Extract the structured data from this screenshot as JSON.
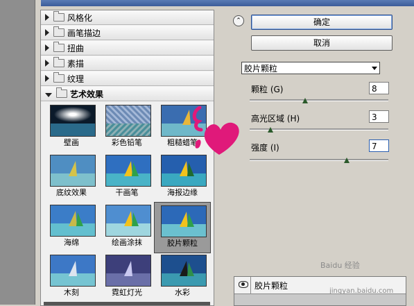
{
  "buttons": {
    "ok": "确定",
    "cancel": "取消"
  },
  "categories": [
    {
      "label": "风格化",
      "expanded": false
    },
    {
      "label": "画笔描边",
      "expanded": false
    },
    {
      "label": "扭曲",
      "expanded": false
    },
    {
      "label": "素描",
      "expanded": false
    },
    {
      "label": "纹理",
      "expanded": false
    },
    {
      "label": "艺术效果",
      "expanded": true
    }
  ],
  "thumbnails": [
    {
      "label": "壁画"
    },
    {
      "label": "彩色铅笔"
    },
    {
      "label": "粗糙蜡笔"
    },
    {
      "label": "底纹效果"
    },
    {
      "label": "干画笔"
    },
    {
      "label": "海报边缘"
    },
    {
      "label": "海绵"
    },
    {
      "label": "绘画涂抹"
    },
    {
      "label": "胶片颗粒",
      "selected": true
    },
    {
      "label": "木刻"
    },
    {
      "label": "霓虹灯光"
    },
    {
      "label": "水彩"
    }
  ],
  "settings": {
    "filter_selected": "胶片颗粒",
    "params": [
      {
        "label": "颗粒 (G)",
        "value": "8",
        "slider_fraction": 0.4
      },
      {
        "label": "高光区域 (H)",
        "value": "3",
        "slider_fraction": 0.15
      },
      {
        "label": "强度 (I)",
        "value": "7",
        "slider_fraction": 0.7
      }
    ]
  },
  "layer": {
    "name": "胶片颗粒"
  },
  "watermark": {
    "brand": "Baidu 经验",
    "url": "jingyan.baidu.com"
  },
  "colors": {
    "accent": "#2b5fb0",
    "deco": "#e0197a"
  }
}
